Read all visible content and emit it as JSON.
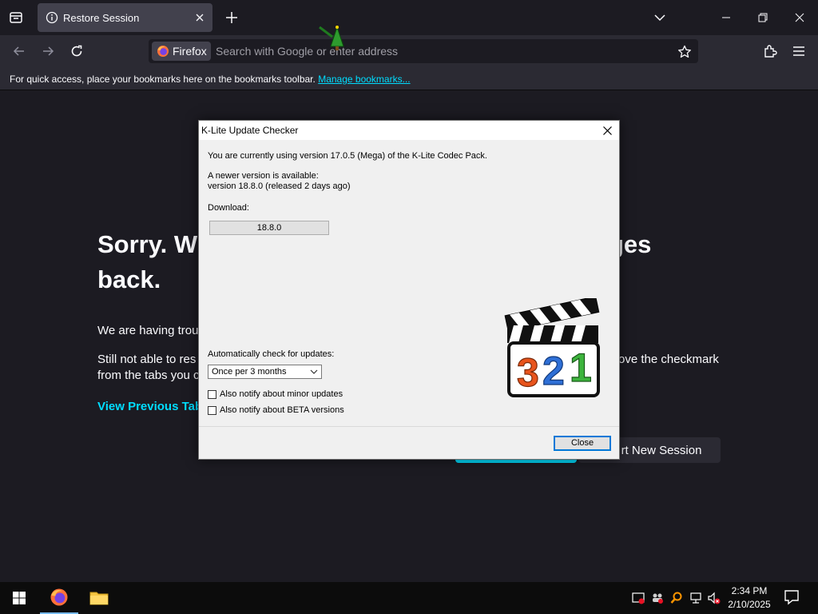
{
  "browser": {
    "tab_title": "Restore Session",
    "identity_label": "Firefox",
    "url_placeholder": "Search with Google or enter address",
    "bookmarks_message": "For quick access, place your bookmarks here on the bookmarks toolbar.",
    "bookmarks_link": "Manage bookmarks..."
  },
  "page": {
    "title": "Sorry. W                                              ges back.",
    "title_line1_left": "Sorry. W",
    "title_line1_right": "ges",
    "title_line2": "back.",
    "p1_left": "We are having trou",
    "p2_left_line1": "Still not able to res",
    "p2_right_line1": "ove the checkmark",
    "p2_left_line2": "from the tabs you c",
    "view_tabs_label": "View Previous Tabs",
    "start_new_label": "rt New Session"
  },
  "dialog": {
    "title": "K-Lite Update Checker",
    "current_version_text": "You are currently using version 17.0.5 (Mega) of the K-Lite Codec Pack.",
    "newer_line1": "A newer version is available:",
    "newer_line2": "version 18.8.0  (released 2 days ago)",
    "download_label": "Download:",
    "download_button": "18.8.0",
    "auto_check_label": "Automatically check for updates:",
    "auto_check_value": "Once per 3 months",
    "minor_updates_label": "Also notify about minor updates",
    "beta_label": "Also notify about BETA versions",
    "close_button": "Close",
    "logo_digits": [
      "3",
      "2",
      "1"
    ]
  },
  "taskbar": {
    "time": "2:34 PM",
    "date": "2/10/2025"
  },
  "colors": {
    "accent": "#00ddff",
    "page_bg": "#1c1b22",
    "dialog_bg": "#f0f0f0"
  }
}
